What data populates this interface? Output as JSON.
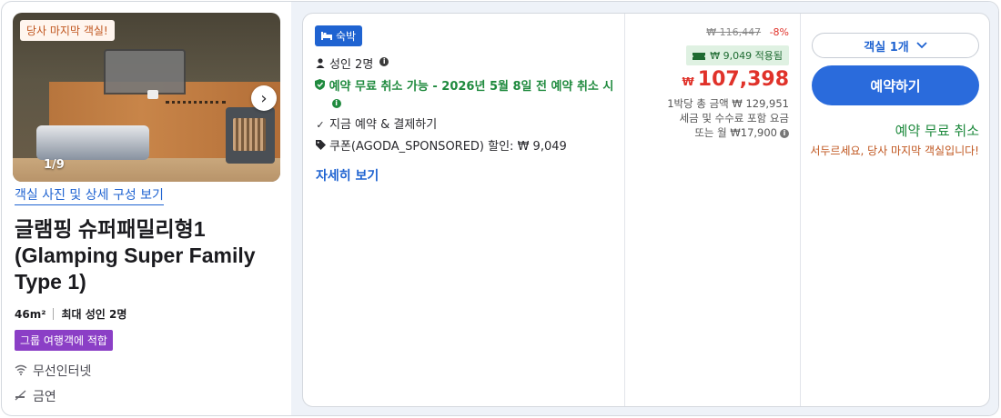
{
  "photo": {
    "badge": "당사 마지막 객실!",
    "counter": "1/9",
    "next_icon": "chevron-right-icon"
  },
  "room": {
    "photos_link": "객실 사진 및 상세 구성 보기",
    "title": "글램핑 슈퍼패밀리형1 (Glamping Super Family Type 1)",
    "size": "46m²",
    "max_guests": "최대 성인 2명",
    "group_tag": "그룹 여행객에 적합",
    "amenities": [
      {
        "icon": "wifi-icon",
        "label": "무선인터넷"
      },
      {
        "icon": "no-smoking-icon",
        "label": "금연"
      }
    ]
  },
  "offer": {
    "stay_badge": "숙박",
    "adults": "성인 2명",
    "free_cancel_text": "예약 무료 취소 가능 - 2026년 5월 8일 전 예약 취소 시",
    "pay_now": "지금 예약 & 결제하기",
    "coupon": "쿠폰(AGODA_SPONSORED) 할인: ₩ 9,049",
    "more_link": "자세히 보기"
  },
  "price": {
    "original": "₩ 116,447",
    "discount": "-8%",
    "coupon_applied": "₩ 9,049 적용됨",
    "currency": "₩",
    "final": "107,398",
    "note_line1": "1박당 총 금액 ₩ 129,951",
    "note_line2": "세금 및 수수료 포함 요금",
    "note_line3": "또는 월 ₩17,900"
  },
  "booking": {
    "room_select": "객실 1개",
    "book_button": "예약하기",
    "free_cancel": "예약 무료 취소",
    "urgency": "서두르세요, 당사 마지막 객실입니다!"
  },
  "colors": {
    "accent_blue": "#2a6bdc",
    "price_red": "#e0322a",
    "green": "#1f8a3e",
    "tag_purple": "#8b3fc6",
    "urgency_orange": "#c0561f"
  }
}
